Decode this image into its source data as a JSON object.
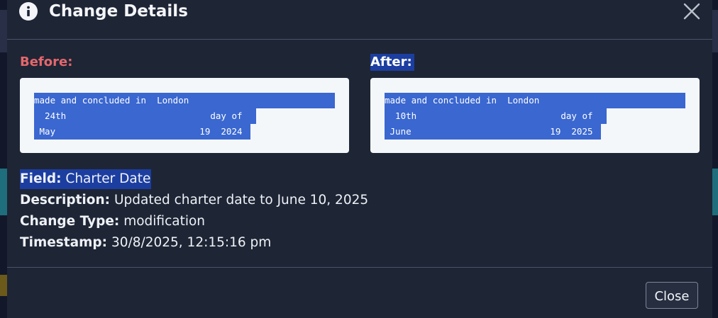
{
  "modal": {
    "title": "Change Details",
    "info_icon": "info-icon",
    "close_icon": "close-icon"
  },
  "before": {
    "label": "Before:",
    "lines": [
      "made and concluded in  London",
      "  24th                           day of",
      " May                           19  2024"
    ]
  },
  "after": {
    "label": "After:",
    "lines": [
      "made and concluded in  London",
      "  10th                           day of",
      " June                          19  2025"
    ]
  },
  "details": {
    "field_label": "Field:",
    "field_value": "Charter Date",
    "description_label": "Description:",
    "description_value": "Updated charter date to June 10, 2025",
    "change_type_label": "Change Type:",
    "change_type_value": "modification",
    "timestamp_label": "Timestamp:",
    "timestamp_value": "30/8/2025, 12:15:16 pm"
  },
  "footer": {
    "close_label": "Close"
  },
  "colors": {
    "modal_bg": "#1e2535",
    "before_label": "#e5676c",
    "highlight": "#1c3ea0",
    "code_highlight": "#3a67d0"
  }
}
